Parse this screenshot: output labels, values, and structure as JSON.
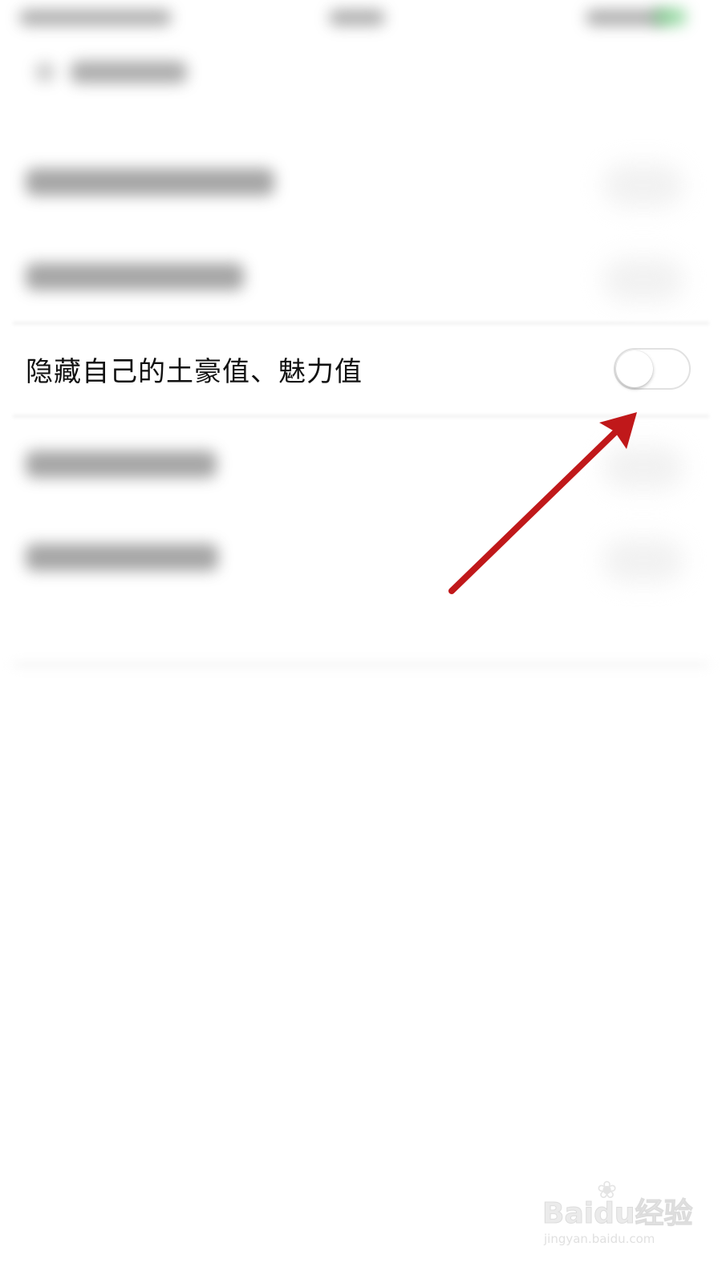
{
  "setting_row": {
    "label": "隐藏自己的土豪值、魅力值",
    "toggle_state": "off"
  },
  "colors": {
    "annotation_arrow": "#c0181a",
    "toggle_border": "#e1e1e1",
    "status_battery": "#56c16a"
  },
  "annotation": {
    "icon": "red-arrow-icon"
  },
  "watermark": {
    "brand": "Baidu经验",
    "url": "jingyan.baidu.com"
  }
}
